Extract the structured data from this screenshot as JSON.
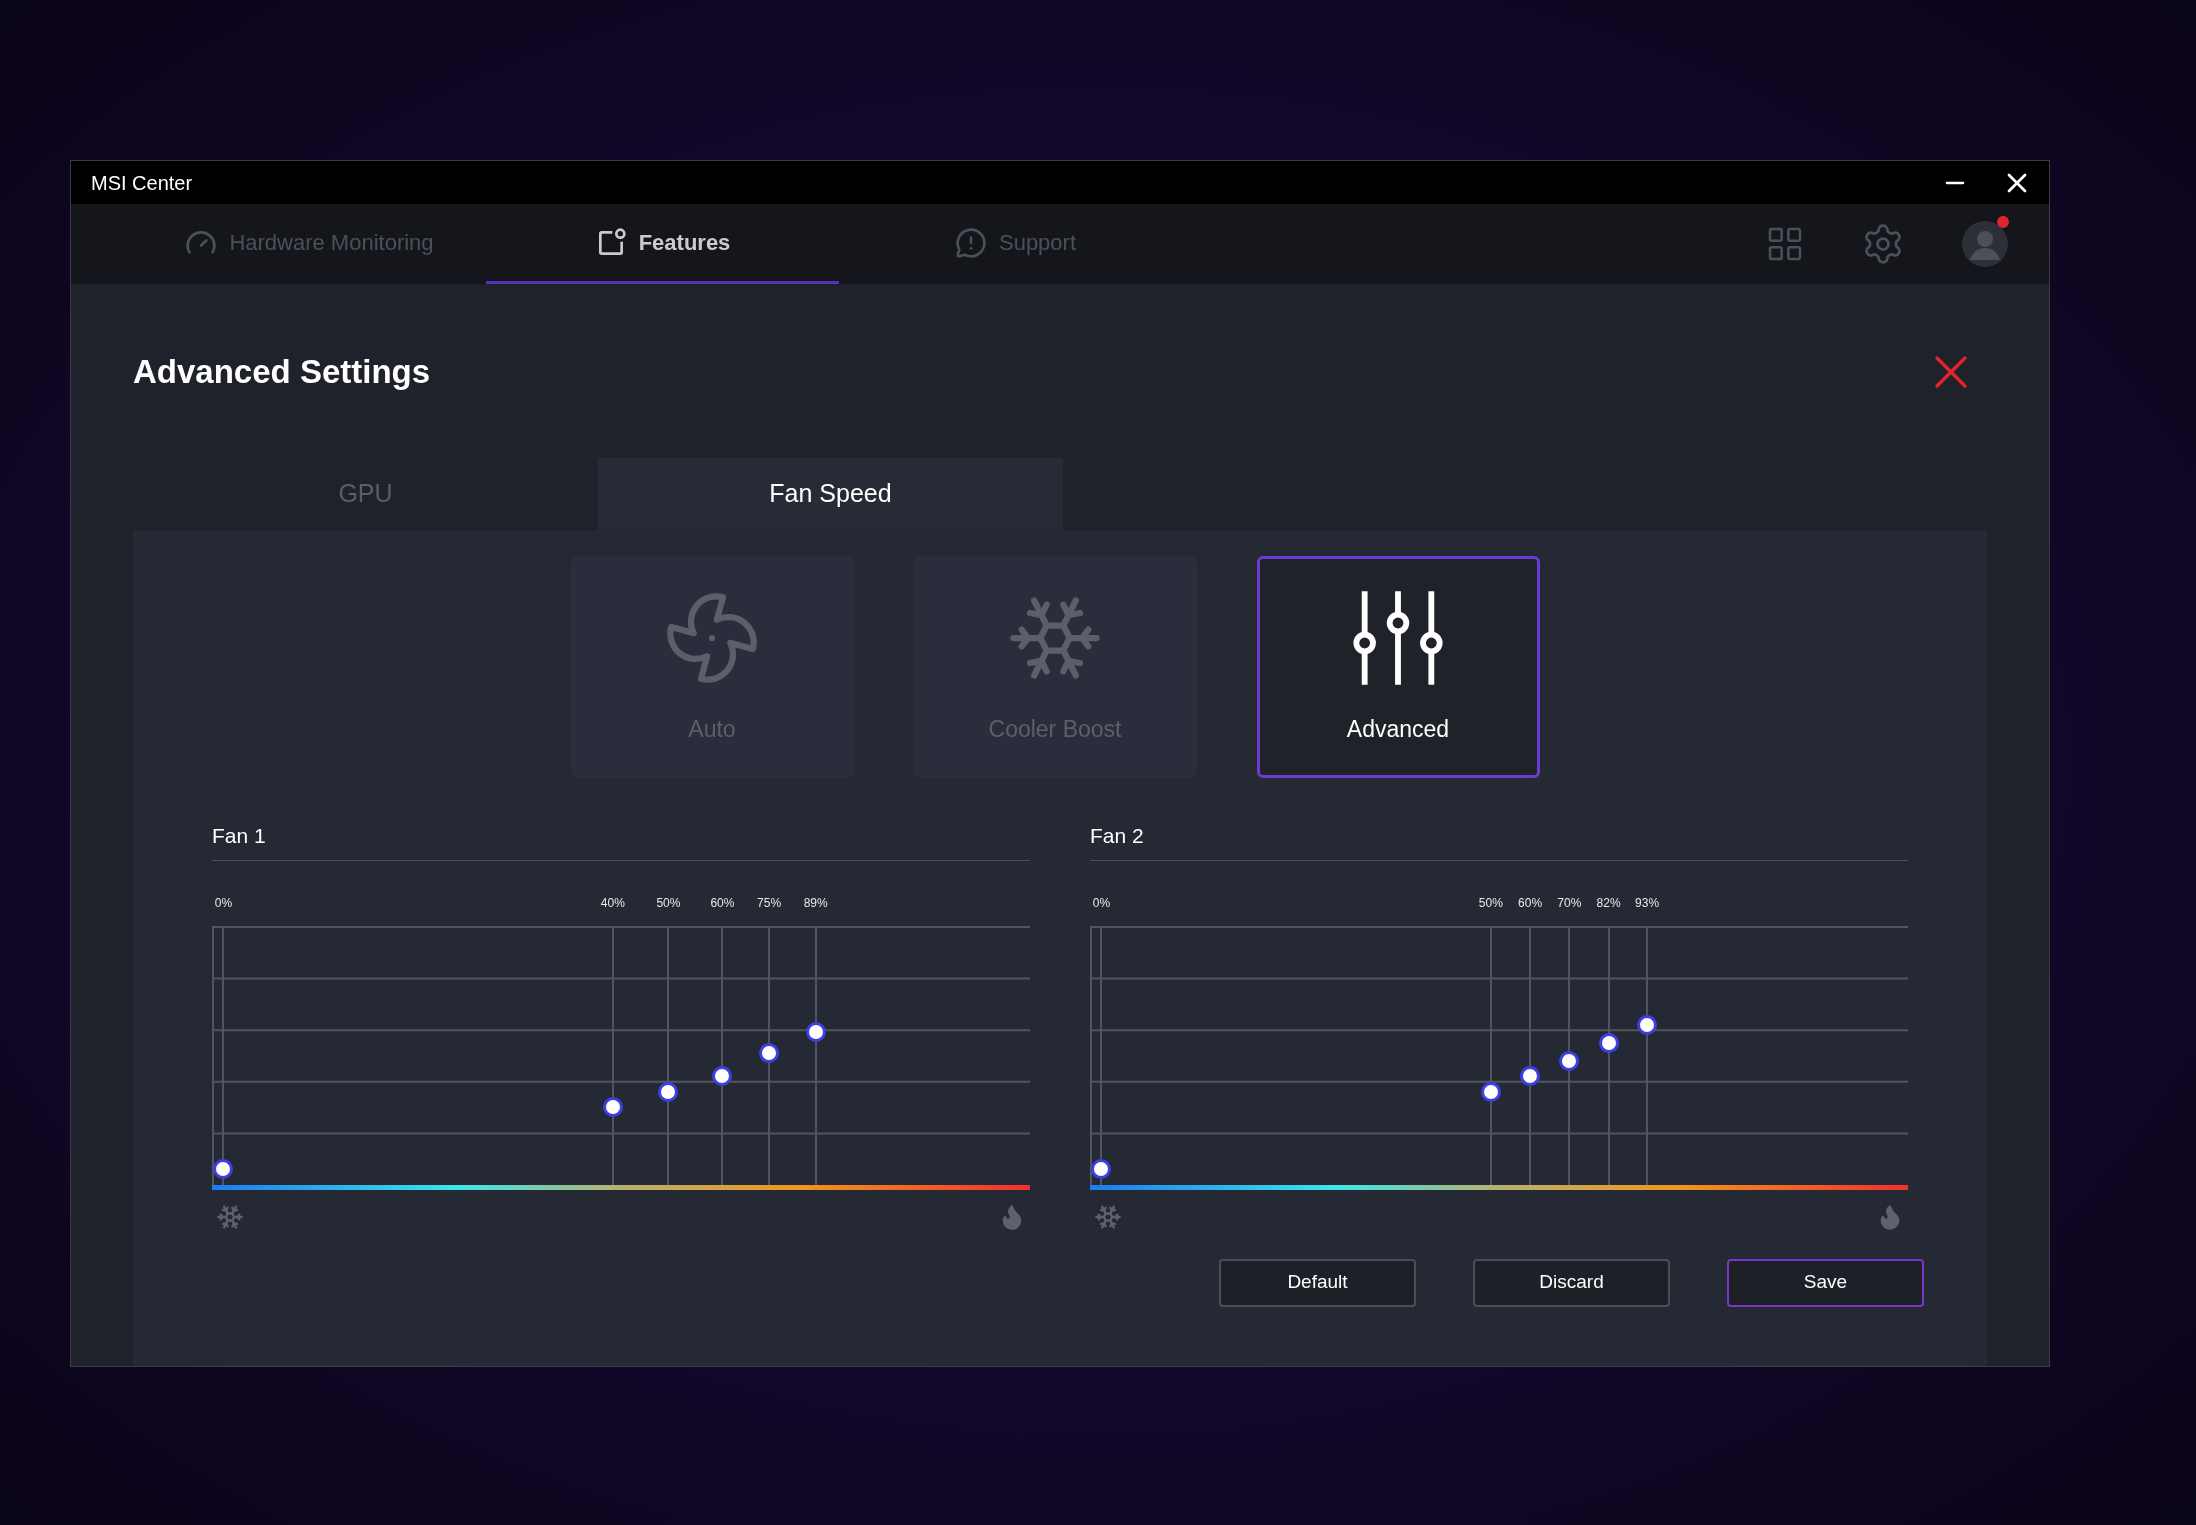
{
  "window": {
    "title": "MSI Center"
  },
  "nav_tabs": [
    {
      "label": "Hardware Monitoring",
      "selected": false,
      "kind": "monitor"
    },
    {
      "label": "Features",
      "selected": true,
      "kind": "features"
    },
    {
      "label": "Support",
      "selected": false,
      "kind": "support"
    }
  ],
  "profile": {
    "notification": true
  },
  "page": {
    "title": "Advanced Settings"
  },
  "tabs": [
    {
      "label": "GPU",
      "selected": false
    },
    {
      "label": "Fan Speed",
      "selected": true
    }
  ],
  "modes": [
    {
      "label": "Auto",
      "kind": "auto",
      "selected": false
    },
    {
      "label": "Cooler Boost",
      "kind": "boost",
      "selected": false
    },
    {
      "label": "Advanced",
      "kind": "advanced",
      "selected": true
    }
  ],
  "fans": [
    {
      "title": "Fan 1",
      "points": [
        {
          "label": "0%",
          "level": 0.06
        },
        {
          "label": "40%",
          "level": 0.3
        },
        {
          "label": "50%",
          "level": 0.36
        },
        {
          "label": "60%",
          "level": 0.42
        },
        {
          "label": "75%",
          "level": 0.51
        },
        {
          "label": "89%",
          "level": 0.59
        }
      ]
    },
    {
      "title": "Fan 2",
      "points": [
        {
          "label": "0%",
          "level": 0.06
        },
        {
          "label": "50%",
          "level": 0.36
        },
        {
          "label": "60%",
          "level": 0.42
        },
        {
          "label": "70%",
          "level": 0.48
        },
        {
          "label": "82%",
          "level": 0.55
        },
        {
          "label": "93%",
          "level": 0.62
        }
      ]
    }
  ],
  "buttons": [
    {
      "label": "Default",
      "kind": "default"
    },
    {
      "label": "Discard",
      "kind": "default"
    },
    {
      "label": "Save",
      "kind": "primary"
    }
  ]
}
